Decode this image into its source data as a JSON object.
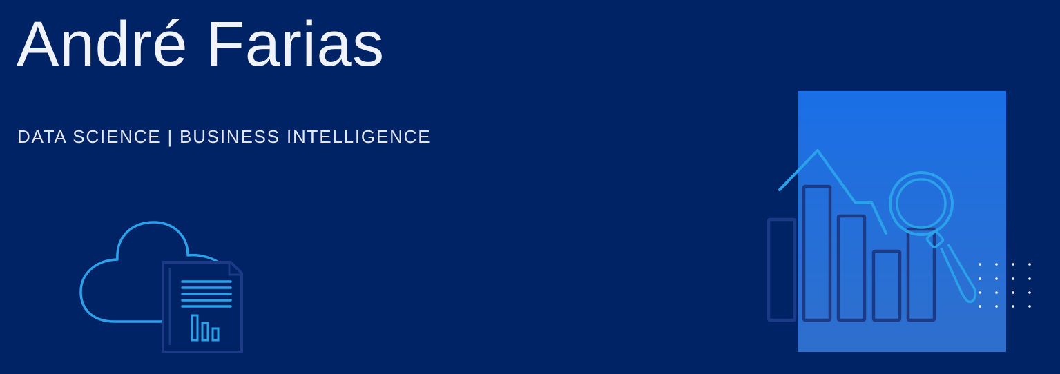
{
  "header": {
    "name": "André Farias",
    "tagline": "DATA SCIENCE | BUSINESS INTELLIGENCE"
  },
  "illustrations": {
    "left_icon": "cloud-document-chart-icon",
    "right_icon": "bar-chart-magnifier-icon"
  },
  "colors": {
    "background": "#002366",
    "text": "#f1f3fb",
    "accent_light": "#2aa1e8",
    "accent_dark": "#1c3a86",
    "panel_top": "#1a6fe6",
    "panel_bottom": "#2f6fcc"
  }
}
